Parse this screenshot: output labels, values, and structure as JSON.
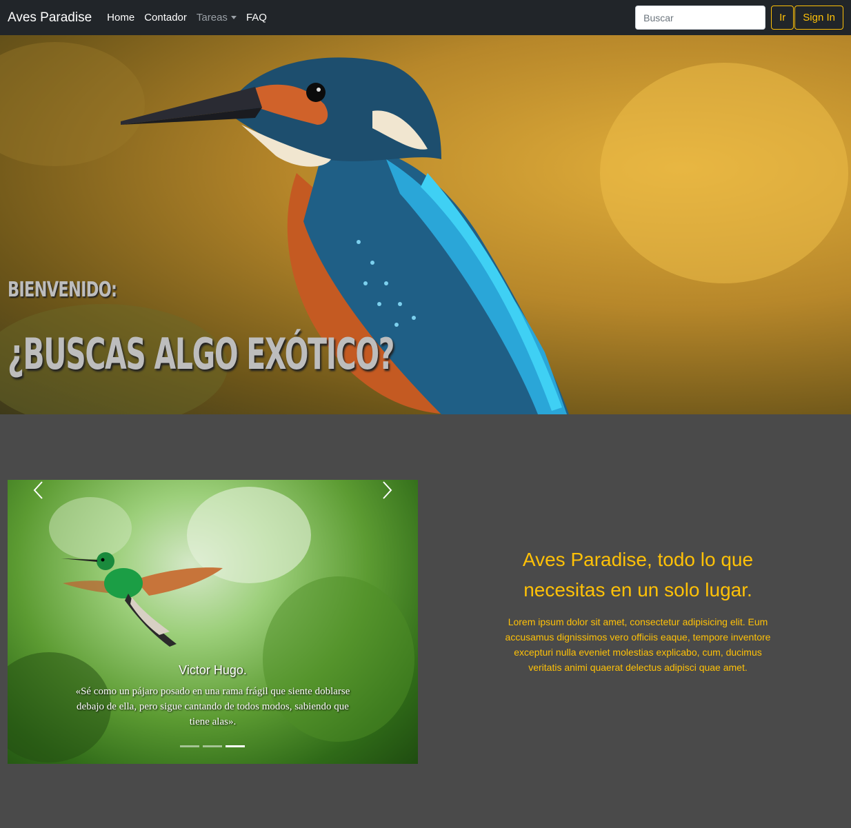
{
  "navbar": {
    "brand": "Aves Paradise",
    "links": [
      "Home",
      "Contador",
      "Tareas",
      "FAQ"
    ],
    "search_placeholder": "Buscar",
    "go_label": "Ir",
    "signin_label": "Sign In"
  },
  "hero": {
    "subtitle": "BIENVENIDO:",
    "title": "¿BUSCAS ALGO EXÓTICO?"
  },
  "carousel": {
    "caption_title": "Victor Hugo.",
    "caption_text": "«Sé como un pájaro posado en una rama frágil que siente doblarse debajo de ella, pero sigue cantando de todos modos, sabiendo que tiene alas».",
    "slide_count": 3,
    "active_slide": 3
  },
  "info": {
    "title": "Aves Paradise, todo lo que necesitas en un solo lugar.",
    "text": "Lorem ipsum dolor sit amet, consectetur adipisicing elit. Eum accusamus dignissimos vero officiis eaque, tempore inventore excepturi nulla eveniet molestias explicabo, cum, ducimus veritatis animi quaerat delectus adipisci quae amet."
  },
  "colors": {
    "navbar_bg": "#212529",
    "accent": "#ffc107",
    "page_bg": "#4a4a4a"
  }
}
